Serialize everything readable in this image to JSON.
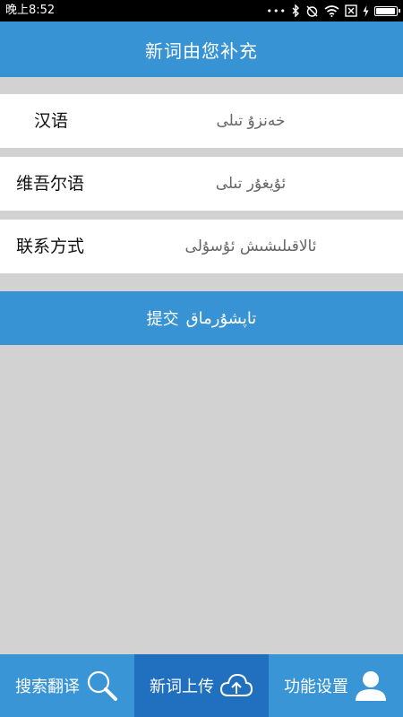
{
  "status_bar": {
    "time": "晚上8:52",
    "dots": "•••"
  },
  "header": {
    "title": "新词由您补充"
  },
  "form": {
    "rows": [
      {
        "label": "汉语",
        "placeholder": "خەنزۇ تىلى"
      },
      {
        "label": "维吾尔语",
        "placeholder": "ئۇيغۇر تىلى"
      },
      {
        "label": "联系方式",
        "placeholder": "ئالاقىلىشىش ئۇسۇلى"
      }
    ]
  },
  "submit": {
    "label_zh": "提交",
    "label_ug": "تاپشۇرماق"
  },
  "bottom_nav": {
    "items": [
      {
        "label": "搜索翻译",
        "icon": "search-icon"
      },
      {
        "label": "新词上传",
        "icon": "cloud-upload-icon",
        "active": true
      },
      {
        "label": "功能设置",
        "icon": "user-icon"
      }
    ]
  },
  "colors": {
    "primary": "#3793d4",
    "nav_active": "#2170c0",
    "page_bg": "#d2d2d2"
  }
}
